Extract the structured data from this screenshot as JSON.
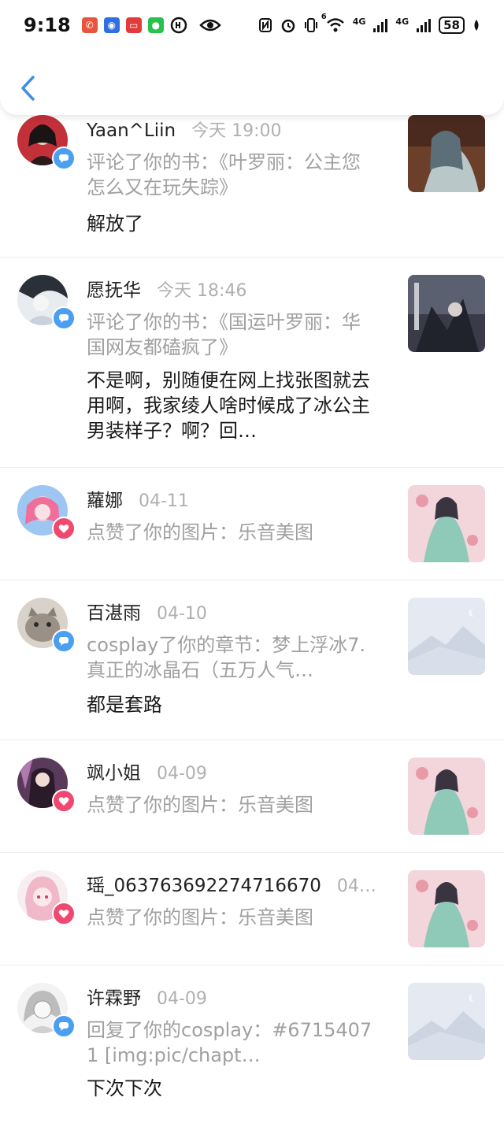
{
  "status_bar": {
    "time": "9:18",
    "battery": "58",
    "network_1": "4G",
    "network_2": "4G",
    "wifi_badge": "6"
  },
  "colors": {
    "comment_badge": "#4a9ff0",
    "like_badge": "#f0486e",
    "back_arrow": "#3d8fe8"
  },
  "notifications": [
    {
      "user": "Yaan^Liin",
      "time": "今天 19:00",
      "action": "评论了你的书：《叶罗丽：公主您怎么又在玩失踪》",
      "message": "解放了",
      "type": "comment",
      "thumb": "book-cover-1"
    },
    {
      "user": "愿抚华",
      "time": "今天 18:46",
      "action": "评论了你的书：《国运叶罗丽：华国网友都磕疯了》",
      "message": "不是啊，别随便在网上找张图就去用啊，我家绫人啥时候成了冰公主男装样子？啊？回…",
      "type": "comment",
      "thumb": "book-cover-2"
    },
    {
      "user": "蘿娜",
      "time": "04-11",
      "action": "点赞了你的图片：乐音美图",
      "message": "",
      "type": "like",
      "thumb": "illustration"
    },
    {
      "user": "百湛雨",
      "time": "04-10",
      "action": "cosplay了你的章节：梦上浮冰7.真正的冰晶石（五万人气…",
      "message": "都是套路",
      "type": "comment",
      "thumb": "placeholder"
    },
    {
      "user": "飒小姐",
      "time": "04-09",
      "action": "点赞了你的图片：乐音美图",
      "message": "",
      "type": "like",
      "thumb": "illustration"
    },
    {
      "user": "瑶_063763692274716670",
      "time": "04…",
      "action": "点赞了你的图片：乐音美图",
      "message": "",
      "type": "like",
      "thumb": "illustration"
    },
    {
      "user": "许霖野",
      "time": "04-09",
      "action": "回复了你的cosplay：#67154071 [img:pic/chapt…",
      "message": "下次下次",
      "type": "comment",
      "thumb": "placeholder"
    }
  ]
}
